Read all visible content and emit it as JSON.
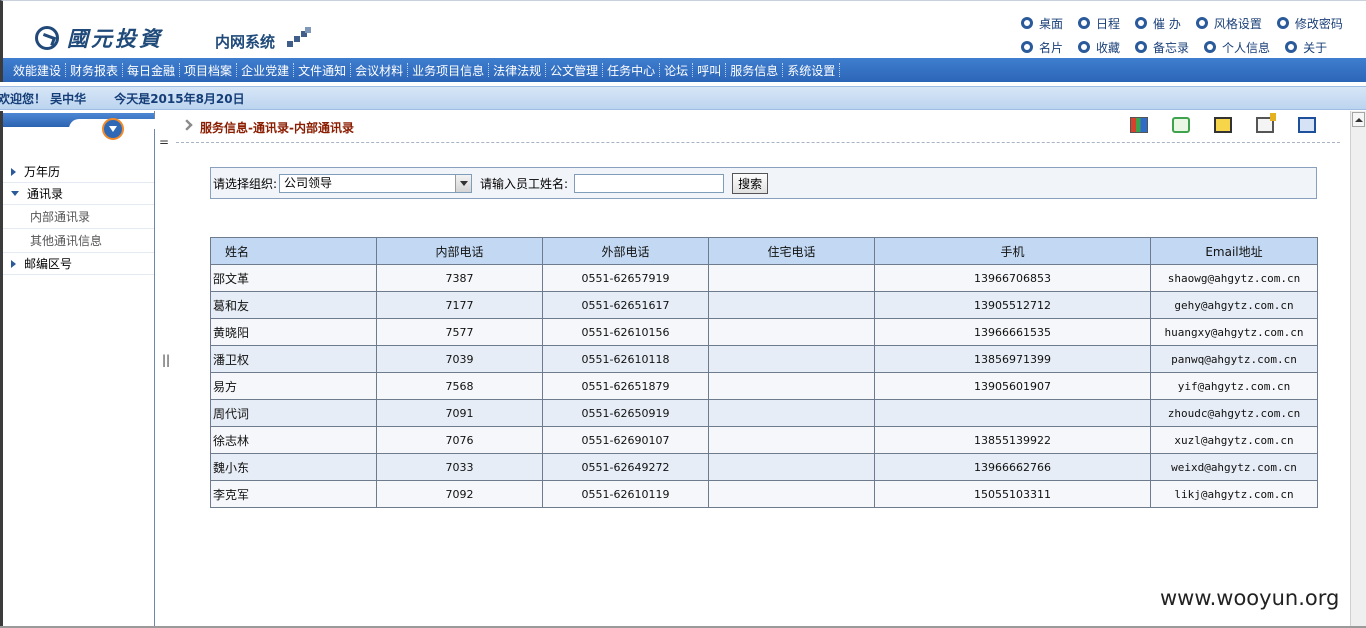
{
  "header": {
    "logo_text": "國元投資",
    "system_name": "内网系统",
    "quick_links_row1": [
      {
        "label": "桌面",
        "icon": "desktop-icon"
      },
      {
        "label": "日程",
        "icon": "schedule-icon"
      },
      {
        "label": "催  办",
        "icon": "reminder-icon"
      },
      {
        "label": "风格设置",
        "icon": "style-icon"
      },
      {
        "label": "修改密码",
        "icon": "password-icon"
      }
    ],
    "quick_links_row2": [
      {
        "label": "名片",
        "icon": "card-icon"
      },
      {
        "label": "收藏",
        "icon": "favorites-icon"
      },
      {
        "label": "备忘录",
        "icon": "memo-icon"
      },
      {
        "label": "个人信息",
        "icon": "profile-icon"
      },
      {
        "label": "关于",
        "icon": "about-icon"
      }
    ]
  },
  "menu": [
    "效能建设",
    "财务报表",
    "每日金融",
    "项目档案",
    "企业党建",
    "文件通知",
    "会议材料",
    "业务项目信息",
    "法律法规",
    "公文管理",
    "任务中心",
    "论坛",
    "呼叫",
    "服务信息",
    "系统设置"
  ],
  "welcome": {
    "text": "欢迎您！ 吴中华",
    "date": "今天是2015年8月20日"
  },
  "sidebar": {
    "items": [
      {
        "label": "万年历",
        "expanded": false
      },
      {
        "label": "通讯录",
        "expanded": true,
        "children": [
          "内部通讯录",
          "其他通讯信息"
        ]
      },
      {
        "label": "邮编区号",
        "expanded": false
      }
    ]
  },
  "splitter": {
    "top": "=",
    "mid": "||"
  },
  "main": {
    "breadcrumb": "服务信息-通讯录-内部通讯录",
    "toolbar_icons": [
      "grid-icon",
      "refresh-icon",
      "back-icon",
      "note-icon",
      "book-icon"
    ],
    "search": {
      "org_label": "请选择组织:",
      "org_value": "公司领导",
      "name_label": "请输入员工姓名:",
      "name_value": "",
      "button": "搜索"
    },
    "table": {
      "headers": [
        "姓名",
        "内部电话",
        "外部电话",
        "住宅电话",
        "手机",
        "Email地址"
      ],
      "rows": [
        [
          "邵文革",
          "7387",
          "0551-62657919",
          "",
          "13966706853",
          "shaowg@ahgytz.com.cn"
        ],
        [
          "葛和友",
          "7177",
          "0551-62651617",
          "",
          "13905512712",
          "gehy@ahgytz.com.cn"
        ],
        [
          "黄晓阳",
          "7577",
          "0551-62610156",
          "",
          "13966661535",
          "huangxy@ahgytz.com.cn"
        ],
        [
          "潘卫权",
          "7039",
          "0551-62610118",
          "",
          "13856971399",
          "panwq@ahgytz.com.cn"
        ],
        [
          "易方",
          "7568",
          "0551-62651879",
          "",
          "13905601907",
          "yif@ahgytz.com.cn"
        ],
        [
          "周代词",
          "7091",
          "0551-62650919",
          "",
          "",
          "zhoudc@ahgytz.com.cn"
        ],
        [
          "徐志林",
          "7076",
          "0551-62690107",
          "",
          "13855139922",
          "xuzl@ahgytz.com.cn"
        ],
        [
          "魏小东",
          "7033",
          "0551-62649272",
          "",
          "13966662766",
          "weixd@ahgytz.com.cn"
        ],
        [
          "李克军",
          "7092",
          "0551-62610119",
          "",
          "15055103311",
          "likj@ahgytz.com.cn"
        ]
      ]
    }
  },
  "watermark": "www.wooyun.org",
  "colors": {
    "menu_bg": "#2c66b8",
    "header_text": "#1f4a7a",
    "breadcrumb": "#8b1d00",
    "table_header": "#c3d9f3"
  }
}
